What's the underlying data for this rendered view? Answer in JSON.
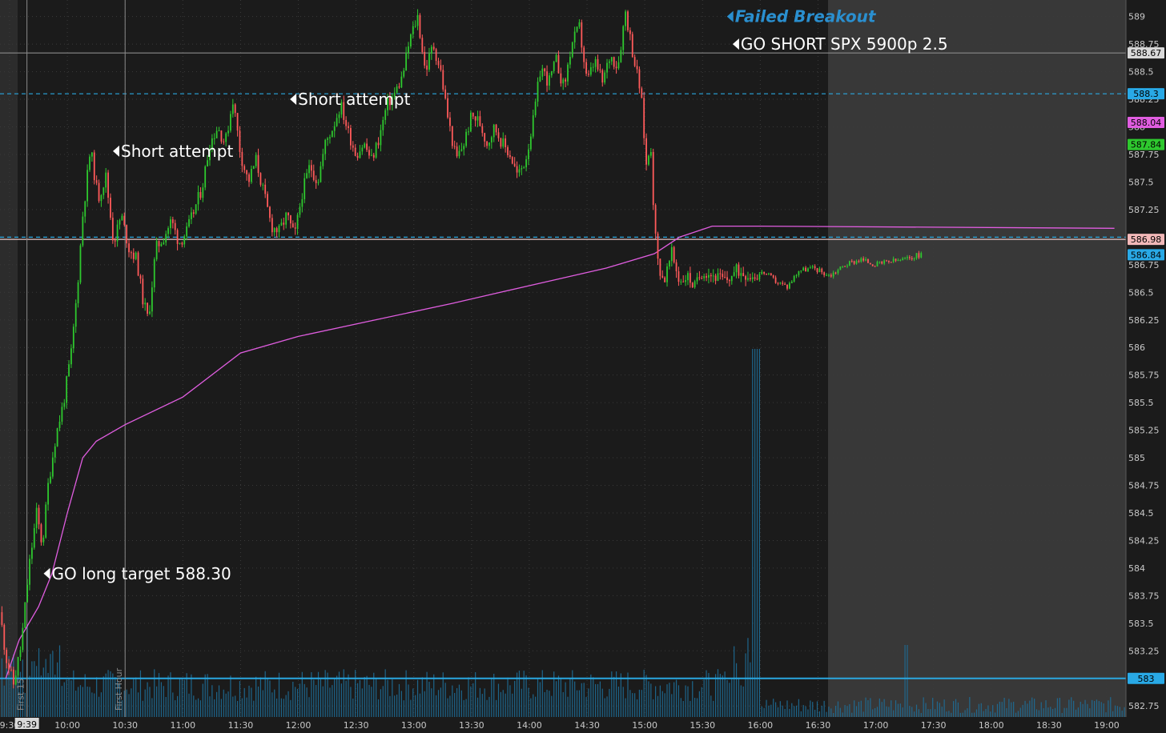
{
  "chart_data": {
    "type": "candlestick",
    "symbol_hint": "SPY intraday",
    "y_ticks": [
      589,
      588.75,
      588.5,
      588.25,
      588,
      587.75,
      587.5,
      587.25,
      587,
      586.75,
      586.5,
      586.25,
      586,
      585.75,
      585.5,
      585.25,
      585,
      584.75,
      584.5,
      584.25,
      584,
      583.75,
      583.5,
      583.25,
      583,
      582.75
    ],
    "ylim": [
      582.65,
      589.15
    ],
    "x_ticks": [
      "9:30",
      "10:00",
      "10:30",
      "11:00",
      "11:30",
      "12:00",
      "12:30",
      "13:00",
      "13:30",
      "14:00",
      "14:30",
      "15:00",
      "15:30",
      "16:00",
      "16:30",
      "17:00",
      "17:30",
      "18:00",
      "18:30",
      "19:00"
    ],
    "x_range_minutes": [
      565,
      1150
    ],
    "cursor_time_label": "9:39",
    "session_close_minute": 960,
    "price_tags": [
      {
        "label": "588.67",
        "value": 588.67,
        "bg": "#d9d9d9",
        "fg": "#000000"
      },
      {
        "label": "588.3",
        "value": 588.3,
        "bg": "#29a9e6",
        "fg": "#000000"
      },
      {
        "label": "588.04",
        "value": 588.04,
        "bg": "#e05de0",
        "fg": "#000000"
      },
      {
        "label": "587.84",
        "value": 587.84,
        "bg": "#2ec82e",
        "fg": "#000000"
      },
      {
        "label": "586.98",
        "value": 586.98,
        "bg": "#f2b8b8",
        "fg": "#000000"
      },
      {
        "label": "586.84",
        "value": 586.84,
        "bg": "#29a9e6",
        "fg": "#000000"
      },
      {
        "label": "583",
        "value": 583.0,
        "bg": "#29a9e6",
        "fg": "#000000"
      }
    ],
    "horizontal_lines": [
      {
        "value": 588.3,
        "style": "dashed",
        "color": "#2aa7e0"
      },
      {
        "value": 587.0,
        "style": "dashed",
        "color": "#2aa7e0"
      },
      {
        "value": 586.98,
        "style": "solid",
        "color": "#e6c6c6"
      },
      {
        "value": 583.0,
        "style": "solid",
        "color": "#2aa7e0"
      },
      {
        "value": 588.67,
        "style": "solid",
        "color": "#8a8a8a"
      }
    ],
    "vertical_markers": [
      {
        "minute": 579,
        "label": "First 15"
      },
      {
        "minute": 630,
        "label": "First Hour"
      }
    ],
    "annotations": [
      {
        "text": "GO long target 588.30",
        "minute": 591,
        "value": 583.95,
        "color": "#ffffff",
        "style": "normal"
      },
      {
        "text": "Short attempt",
        "minute": 627,
        "value": 587.78,
        "color": "#ffffff",
        "style": "normal"
      },
      {
        "text": "Short attempt",
        "minute": 719,
        "value": 588.25,
        "color": "#ffffff",
        "style": "normal"
      },
      {
        "text": "Failed Breakout",
        "minute": 946,
        "value": 589.0,
        "color": "#2a8fcf",
        "style": "bold-italic"
      },
      {
        "text": "GO SHORT SPX 5900p 2.5",
        "minute": 949,
        "value": 588.75,
        "color": "#ffffff",
        "style": "normal"
      }
    ],
    "price_path": [
      [
        565,
        583.6
      ],
      [
        568,
        583.2
      ],
      [
        572,
        582.95
      ],
      [
        576,
        583.3
      ],
      [
        580,
        584.0
      ],
      [
        584,
        584.5
      ],
      [
        587,
        584.2
      ],
      [
        590,
        584.75
      ],
      [
        594,
        585.2
      ],
      [
        598,
        585.5
      ],
      [
        602,
        585.95
      ],
      [
        605,
        586.5
      ],
      [
        608,
        587.2
      ],
      [
        612,
        587.8
      ],
      [
        616,
        587.35
      ],
      [
        620,
        587.55
      ],
      [
        624,
        586.95
      ],
      [
        628,
        587.2
      ],
      [
        632,
        586.9
      ],
      [
        636,
        586.8
      ],
      [
        639,
        586.45
      ],
      [
        642,
        586.25
      ],
      [
        646,
        586.9
      ],
      [
        650,
        587.0
      ],
      [
        654,
        587.15
      ],
      [
        658,
        586.95
      ],
      [
        662,
        587.05
      ],
      [
        666,
        587.25
      ],
      [
        670,
        587.45
      ],
      [
        674,
        587.85
      ],
      [
        678,
        588.0
      ],
      [
        682,
        587.85
      ],
      [
        686,
        588.25
      ],
      [
        690,
        587.75
      ],
      [
        694,
        587.5
      ],
      [
        698,
        587.7
      ],
      [
        702,
        587.4
      ],
      [
        706,
        587.1
      ],
      [
        710,
        587.05
      ],
      [
        714,
        587.2
      ],
      [
        718,
        587.0
      ],
      [
        722,
        587.4
      ],
      [
        726,
        587.65
      ],
      [
        730,
        587.5
      ],
      [
        734,
        587.85
      ],
      [
        738,
        588.0
      ],
      [
        742,
        588.2
      ],
      [
        746,
        587.95
      ],
      [
        750,
        587.75
      ],
      [
        754,
        587.85
      ],
      [
        758,
        587.7
      ],
      [
        762,
        587.9
      ],
      [
        766,
        588.2
      ],
      [
        770,
        588.3
      ],
      [
        774,
        588.45
      ],
      [
        778,
        588.8
      ],
      [
        782,
        589.0
      ],
      [
        786,
        588.5
      ],
      [
        790,
        588.75
      ],
      [
        794,
        588.5
      ],
      [
        798,
        588.05
      ],
      [
        802,
        587.7
      ],
      [
        806,
        587.85
      ],
      [
        810,
        588.1
      ],
      [
        814,
        588.05
      ],
      [
        818,
        587.85
      ],
      [
        822,
        588.0
      ],
      [
        826,
        587.85
      ],
      [
        830,
        587.75
      ],
      [
        834,
        587.55
      ],
      [
        838,
        587.7
      ],
      [
        842,
        588.05
      ],
      [
        846,
        588.55
      ],
      [
        850,
        588.4
      ],
      [
        854,
        588.6
      ],
      [
        858,
        588.35
      ],
      [
        862,
        588.75
      ],
      [
        866,
        588.9
      ],
      [
        870,
        588.4
      ],
      [
        874,
        588.6
      ],
      [
        878,
        588.4
      ],
      [
        882,
        588.65
      ],
      [
        886,
        588.55
      ],
      [
        890,
        589.05
      ],
      [
        894,
        588.65
      ],
      [
        898,
        588.3
      ],
      [
        901,
        587.6
      ],
      [
        903,
        587.9
      ],
      [
        905,
        587.1
      ],
      [
        907,
        586.75
      ],
      [
        910,
        586.6
      ],
      [
        914,
        586.85
      ],
      [
        918,
        586.6
      ],
      [
        922,
        586.65
      ],
      [
        926,
        586.55
      ],
      [
        930,
        586.7
      ],
      [
        936,
        586.65
      ],
      [
        942,
        586.6
      ],
      [
        948,
        586.7
      ],
      [
        956,
        586.65
      ],
      [
        962,
        586.68
      ],
      [
        968,
        586.6
      ],
      [
        974,
        586.55
      ],
      [
        980,
        586.7
      ],
      [
        988,
        586.72
      ],
      [
        996,
        586.65
      ],
      [
        1004,
        586.75
      ],
      [
        1012,
        586.8
      ],
      [
        1020,
        586.75
      ],
      [
        1028,
        586.78
      ],
      [
        1036,
        586.8
      ],
      [
        1044,
        586.85
      ]
    ],
    "vwap_path": [
      [
        568,
        583.0
      ],
      [
        575,
        583.35
      ],
      [
        585,
        583.65
      ],
      [
        592,
        583.95
      ],
      [
        600,
        584.5
      ],
      [
        608,
        585.0
      ],
      [
        615,
        585.15
      ],
      [
        630,
        585.3
      ],
      [
        660,
        585.55
      ],
      [
        690,
        585.95
      ],
      [
        720,
        586.1
      ],
      [
        760,
        586.25
      ],
      [
        800,
        586.4
      ],
      [
        820,
        586.48
      ],
      [
        850,
        586.6
      ],
      [
        880,
        586.72
      ],
      [
        905,
        586.85
      ],
      [
        918,
        587.0
      ],
      [
        935,
        587.1
      ],
      [
        960,
        587.1
      ],
      [
        1144,
        587.08
      ]
    ],
    "volume_profile": "clustered bars at bottom; spike near 15:45 then post-market low volume"
  }
}
